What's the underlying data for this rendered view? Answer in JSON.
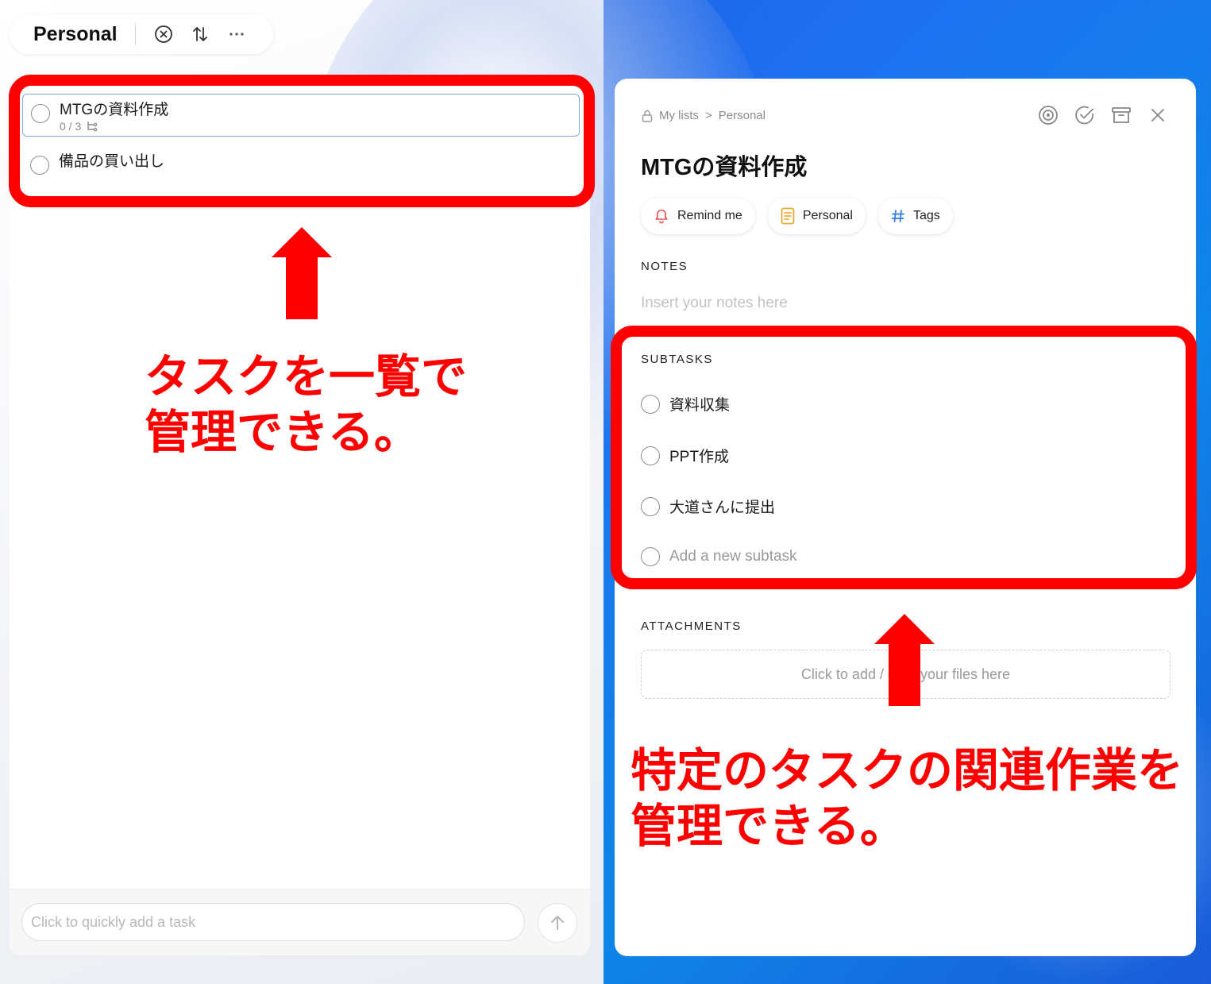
{
  "header": {
    "list_title": "Personal"
  },
  "tasks": [
    {
      "title": "MTGの資料作成",
      "meta": "0 / 3"
    },
    {
      "title": "備品の買い出し"
    }
  ],
  "quick_add": {
    "placeholder": "Click to quickly add a task"
  },
  "detail": {
    "breadcrumb": {
      "root": "My lists",
      "separator": ">",
      "current": "Personal"
    },
    "title": "MTGの資料作成",
    "chips": {
      "remind": "Remind me",
      "list": "Personal",
      "tags": "Tags"
    },
    "notes_label": "NOTES",
    "notes_placeholder": "Insert your notes here",
    "subtasks_label": "SUBTASKS",
    "subtasks": [
      "資料収集",
      "PPT作成",
      "大道さんに提出"
    ],
    "add_subtask": "Add a new subtask",
    "attachments_label": "ATTACHMENTS",
    "dropzone": "Click to add / drop your files here"
  },
  "annotations": {
    "left_caption": "タスクを一覧で\n管理できる。",
    "right_caption": "特定のタスクの関連作業を\n管理できる。",
    "color": "#ff0000"
  },
  "colors": {
    "accent_blue": "#2f7be8",
    "bell_red": "#e85050",
    "note_orange": "#f0a020"
  }
}
